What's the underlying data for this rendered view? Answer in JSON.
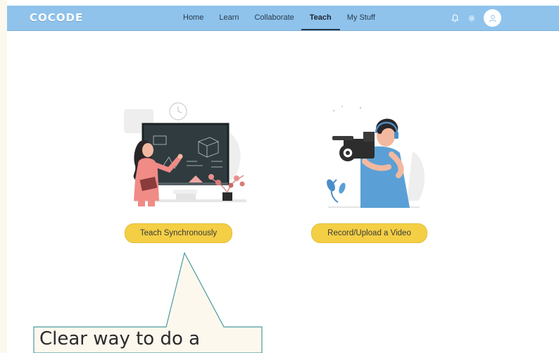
{
  "brand": {
    "logo_text": "COCODE"
  },
  "nav": {
    "links": [
      {
        "label": "Home",
        "active": false
      },
      {
        "label": "Learn",
        "active": false
      },
      {
        "label": "Collaborate",
        "active": false
      },
      {
        "label": "Teach",
        "active": true
      },
      {
        "label": "My Stuff",
        "active": false
      }
    ],
    "icons": [
      "bell-icon",
      "gear-icon",
      "user-icon"
    ]
  },
  "options": {
    "teach_sync_label": "Teach Synchronously",
    "record_upload_label": "Record/Upload a Video",
    "teach_sync_illustration": "teacher-at-blackboard",
    "record_upload_illustration": "person-with-video-camera"
  },
  "annotation": {
    "text": "Clear way to do a"
  },
  "colors": {
    "navbar": "#8fc3ec",
    "button": "#f4cf45",
    "page_background": "#fdf8ee",
    "callout_stroke": "#4a9a9e"
  }
}
